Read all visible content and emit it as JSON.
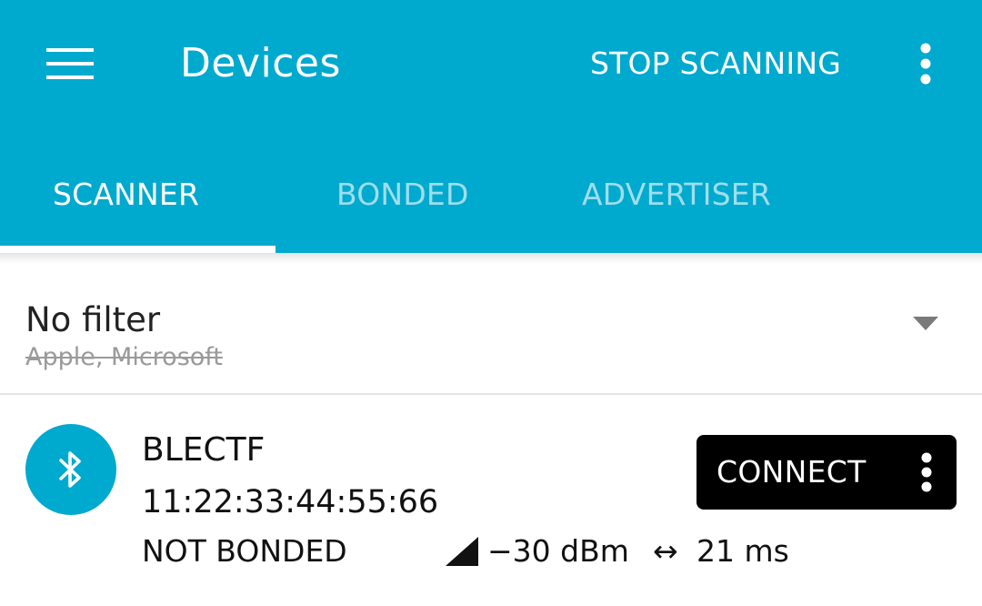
{
  "colors": {
    "appbar": "#00A9CE",
    "accent": "#00A9CE",
    "connect_button": "#000000"
  },
  "appbar": {
    "title": "Devices",
    "action_label": "STOP SCANNING",
    "menu_icon": "hamburger-menu-icon",
    "overflow_icon": "more-vert-icon"
  },
  "tabs": [
    {
      "label": "SCANNER",
      "active": true
    },
    {
      "label": "BONDED",
      "active": false
    },
    {
      "label": "ADVERTISER",
      "active": false
    }
  ],
  "filter": {
    "title": "No filter",
    "excluded": "Apple, Microsoft",
    "dropdown_icon": "arrow-drop-down-icon"
  },
  "devices": [
    {
      "icon": "bluetooth-icon",
      "name": "BLECTF",
      "address": "11:22:33:44:55:66",
      "bond_state": "NOT BONDED",
      "rssi": "−30 dBm",
      "interval_symbol": "↔",
      "interval": "21 ms",
      "connect_label": "CONNECT",
      "more_icon": "more-vert-icon"
    }
  ]
}
